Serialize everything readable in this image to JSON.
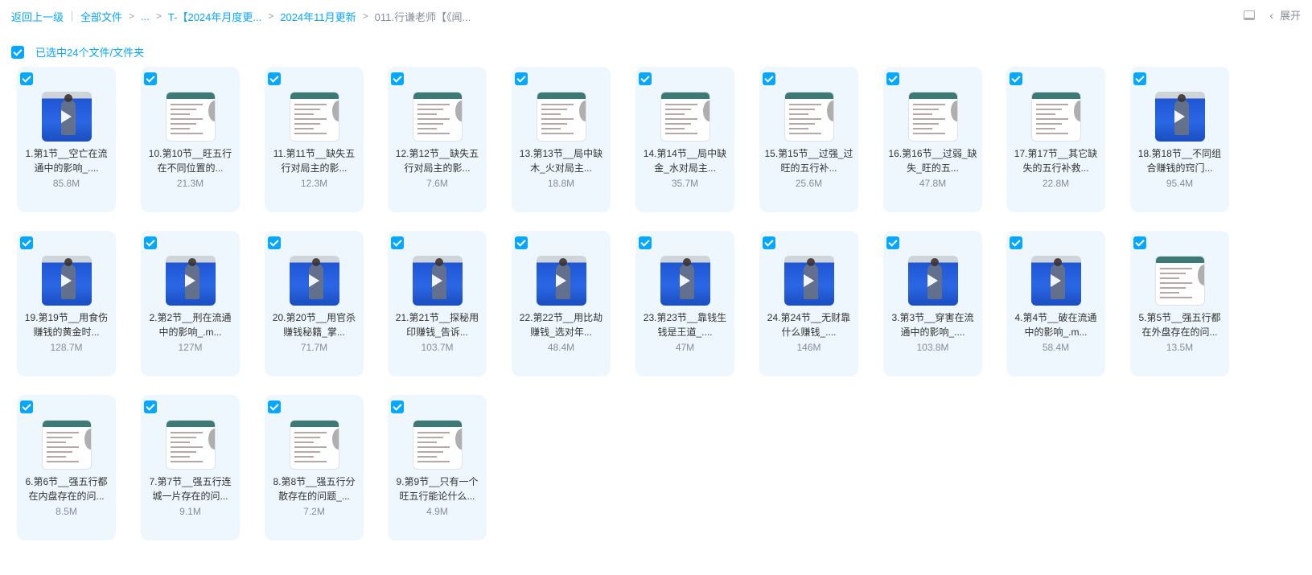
{
  "breadcrumb": {
    "back": "返回上一级",
    "all_files": "全部文件",
    "ellipsis": "...",
    "folder_a": "T-【2024年月度更...",
    "folder_b": "2024年11月更新",
    "current": "011.行谦老师【《闻...",
    "separator": ">"
  },
  "toolbar": {
    "expand_label": "展开",
    "chevron": "‹"
  },
  "selection": {
    "label": "已选中24个文件/文件夹",
    "checked": true
  },
  "files": [
    {
      "name": "1.第1节__空亡在流通中的影响_.mp4",
      "display": "1.第1节__空亡在流通中的影响_....",
      "size": "85.8M",
      "thumb": "video",
      "checked": true
    },
    {
      "name": "10.第10节__旺五行在不同位置的...",
      "display": "10.第10节__旺五行在不同位置的...",
      "size": "21.3M",
      "thumb": "doc",
      "checked": true
    },
    {
      "name": "11.第11节__缺失五行对局主的影...",
      "display": "11.第11节__缺失五行对局主的影...",
      "size": "12.3M",
      "thumb": "doc",
      "checked": true
    },
    {
      "name": "12.第12节__缺失五行对局主的影...",
      "display": "12.第12节__缺失五行对局主的影...",
      "size": "7.6M",
      "thumb": "doc",
      "checked": true
    },
    {
      "name": "13.第13节__局中缺木_火对局主...",
      "display": "13.第13节__局中缺木_火对局主...",
      "size": "18.8M",
      "thumb": "doc",
      "checked": true
    },
    {
      "name": "14.第14节__局中缺金_水对局主...",
      "display": "14.第14节__局中缺金_水对局主...",
      "size": "35.7M",
      "thumb": "doc",
      "checked": true
    },
    {
      "name": "15.第15节__过强_过旺的五行补...",
      "display": "15.第15节__过强_过旺的五行补...",
      "size": "25.6M",
      "thumb": "doc",
      "checked": true
    },
    {
      "name": "16.第16节__过弱_缺失_旺的五...",
      "display": "16.第16节__过弱_缺失_旺的五...",
      "size": "47.8M",
      "thumb": "doc",
      "checked": true
    },
    {
      "name": "17.第17节__其它缺失的五行补救...",
      "display": "17.第17节__其它缺失的五行补救...",
      "size": "22.8M",
      "thumb": "doc",
      "checked": true
    },
    {
      "name": "18.第18节__不同组合赚钱的窍门...",
      "display": "18.第18节__不同组合赚钱的窍门...",
      "size": "95.4M",
      "thumb": "video",
      "checked": true
    },
    {
      "name": "19.第19节__用食伤赚钱的黄金时...",
      "display": "19.第19节__用食伤赚钱的黄金时...",
      "size": "128.7M",
      "thumb": "video",
      "checked": true
    },
    {
      "name": "2.第2节__刑在流通中的影响_.m...",
      "display": "2.第2节__刑在流通中的影响_.m...",
      "size": "127M",
      "thumb": "video",
      "checked": true
    },
    {
      "name": "20.第20节__用官杀赚钱秘籍_掌...",
      "display": "20.第20节__用官杀赚钱秘籍_掌...",
      "size": "71.7M",
      "thumb": "video",
      "checked": true
    },
    {
      "name": "21.第21节__探秘用印赚钱_告诉...",
      "display": "21.第21节__探秘用印赚钱_告诉...",
      "size": "103.7M",
      "thumb": "video",
      "checked": true
    },
    {
      "name": "22.第22节__用比劫赚钱_选对年...",
      "display": "22.第22节__用比劫赚钱_选对年...",
      "size": "48.4M",
      "thumb": "video",
      "checked": true
    },
    {
      "name": "23.第23节__靠钱生钱是王道_....",
      "display": "23.第23节__靠钱生钱是王道_....",
      "size": "47M",
      "thumb": "video",
      "checked": true
    },
    {
      "name": "24.第24节__无财靠什么赚钱_....",
      "display": "24.第24节__无财靠什么赚钱_....",
      "size": "146M",
      "thumb": "video",
      "checked": true
    },
    {
      "name": "3.第3节__穿害在流通中的影响_....",
      "display": "3.第3节__穿害在流通中的影响_....",
      "size": "103.8M",
      "thumb": "video",
      "checked": true
    },
    {
      "name": "4.第4节__破在流通中的影响_.m...",
      "display": "4.第4节__破在流通中的影响_.m...",
      "size": "58.4M",
      "thumb": "video",
      "checked": true
    },
    {
      "name": "5.第5节__强五行都在外盘存在的问...",
      "display": "5.第5节__强五行都在外盘存在的问...",
      "size": "13.5M",
      "thumb": "doc",
      "checked": true
    },
    {
      "name": "6.第6节__强五行都在内盘存在的问...",
      "display": "6.第6节__强五行都在内盘存在的问...",
      "size": "8.5M",
      "thumb": "doc",
      "checked": true
    },
    {
      "name": "7.第7节__强五行连城一片存在的问...",
      "display": "7.第7节__强五行连城一片存在的问...",
      "size": "9.1M",
      "thumb": "doc",
      "checked": true
    },
    {
      "name": "8.第8节__强五行分散存在的问题_...",
      "display": "8.第8节__强五行分散存在的问题_...",
      "size": "7.2M",
      "thumb": "doc",
      "checked": true
    },
    {
      "name": "9.第9节__只有一个旺五行能论什么...",
      "display": "9.第9节__只有一个旺五行能论什么...",
      "size": "4.9M",
      "thumb": "doc",
      "checked": true
    }
  ],
  "colors": {
    "accent": "#06a7ff",
    "card_bg": "#eef7fd",
    "muted": "#878c9c"
  }
}
